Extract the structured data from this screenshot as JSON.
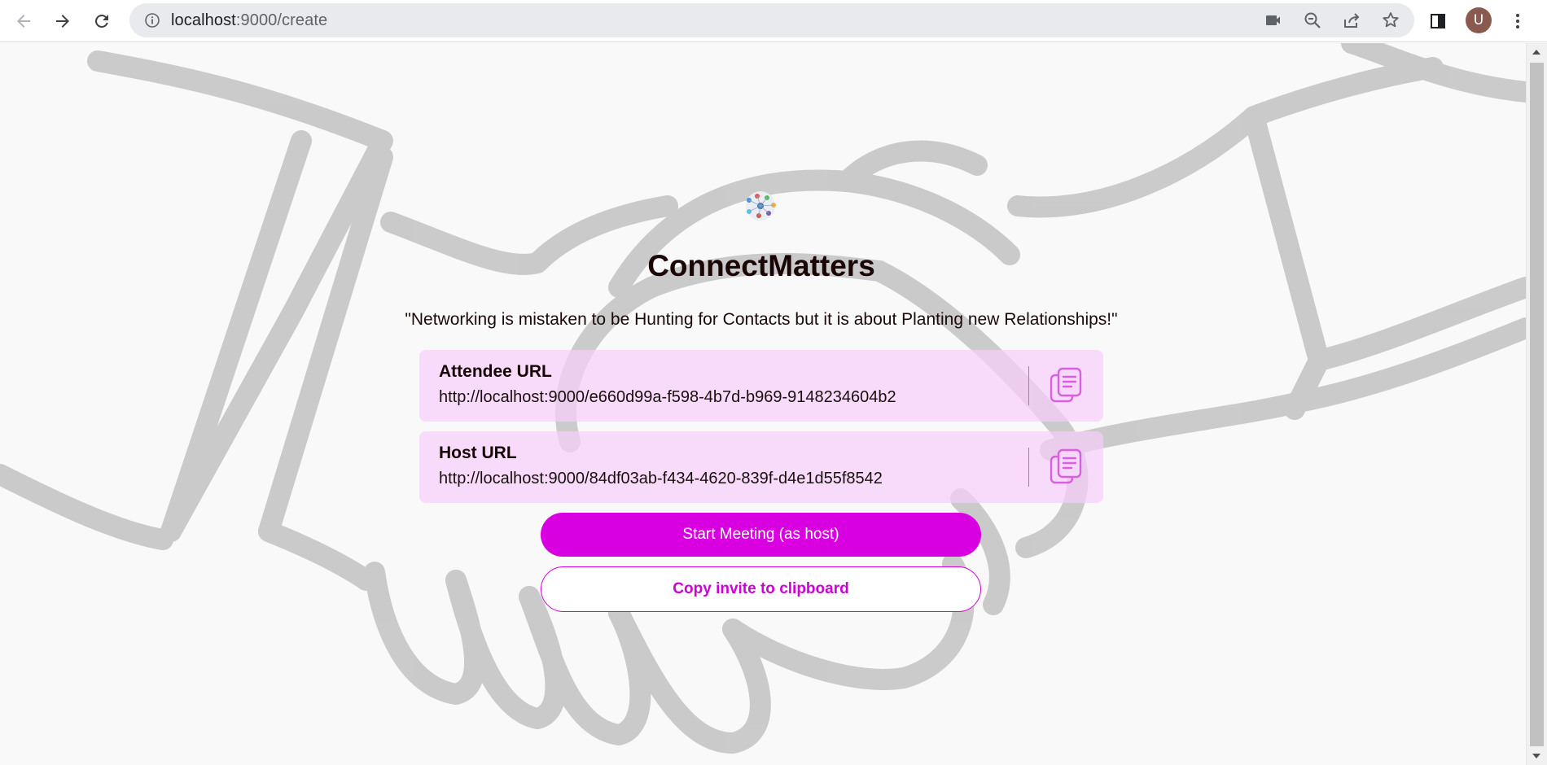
{
  "browser": {
    "url_host": "localhost",
    "url_rest": ":9000/create",
    "avatar_initial": "U",
    "icons": [
      "back-icon",
      "forward-icon",
      "reload-icon",
      "site-info-icon",
      "camera-icon",
      "zoom-out-icon",
      "share-icon",
      "bookmark-star-icon",
      "side-panel-icon",
      "menu-kebab-icon"
    ]
  },
  "page": {
    "app_title": "ConnectMatters",
    "quote": "\"Networking is mistaken to be Hunting for Contacts but it is about Planting new Relationships!\"",
    "attendee": {
      "label": "Attendee URL",
      "url": "http://localhost:9000/e660d99a-f598-4b7d-b969-9148234604b2"
    },
    "host": {
      "label": "Host URL",
      "url": "http://localhost:9000/84df03ab-f434-4620-839f-d4e1d55f8542"
    },
    "start_button": "Start Meeting (as host)",
    "copy_invite_button": "Copy invite to clipboard"
  },
  "colors": {
    "accent": "#d800e0",
    "card_bg": "#f7cdfa",
    "copy_icon": "#d85fe0"
  }
}
